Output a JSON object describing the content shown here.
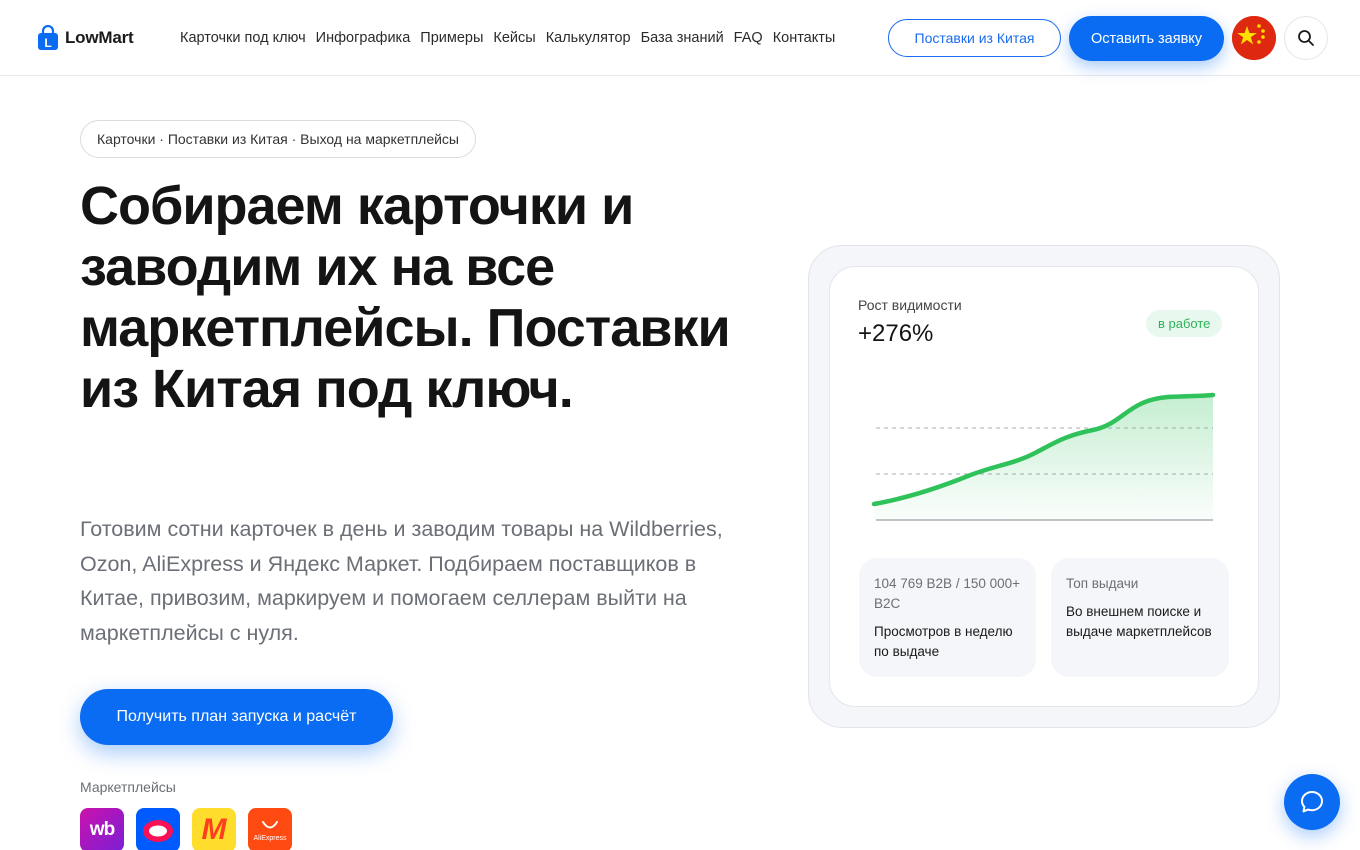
{
  "header": {
    "logo_text": "LowMart",
    "nav": [
      "Карточки под ключ",
      "Инфографика",
      "Примеры",
      "Кейсы",
      "Калькулятор",
      "База знаний",
      "FAQ",
      "Контакты"
    ],
    "china_button": "Поставки из Китая",
    "request_button": "Оставить заявку"
  },
  "hero": {
    "pill": "Карточки · Поставки из Китая · Выход на маркетплейсы",
    "title": "Собираем карточки и заводим их на все маркетплейсы. Поставки из Китая под ключ.",
    "subtitle": "Готовим сотни карточек в день и заводим товары на Wildberries, Ozon, AliExpress и Яндекс Маркет. Подбираем поставщиков в Китае, привозим, маркируем и помогаем селлерам выйти на маркетплейсы с нуля.",
    "cta": "Получить план запуска и расчёт",
    "marketplaces_label": "Маркетплейсы",
    "marketplaces": [
      {
        "name": "wildberries",
        "label": "wb"
      },
      {
        "name": "ozon",
        "label": ""
      },
      {
        "name": "yandex-market",
        "label": "M"
      },
      {
        "name": "aliexpress",
        "label": "AliExpress"
      }
    ]
  },
  "card": {
    "metric_label": "Рост видимости",
    "metric_value": "+276%",
    "status": "в работе",
    "stats": [
      {
        "top": "104 769 B2B / 150 000+ B2C",
        "bottom": "Просмотров в неделю по выдаче"
      },
      {
        "top": "Топ выдачи",
        "bottom": "Во внешнем поиске и выдаче маркетплейсов"
      }
    ]
  },
  "colors": {
    "accent": "#0a6cf2",
    "chart_line": "#2fc25b",
    "badge_text": "#2fb35a"
  }
}
